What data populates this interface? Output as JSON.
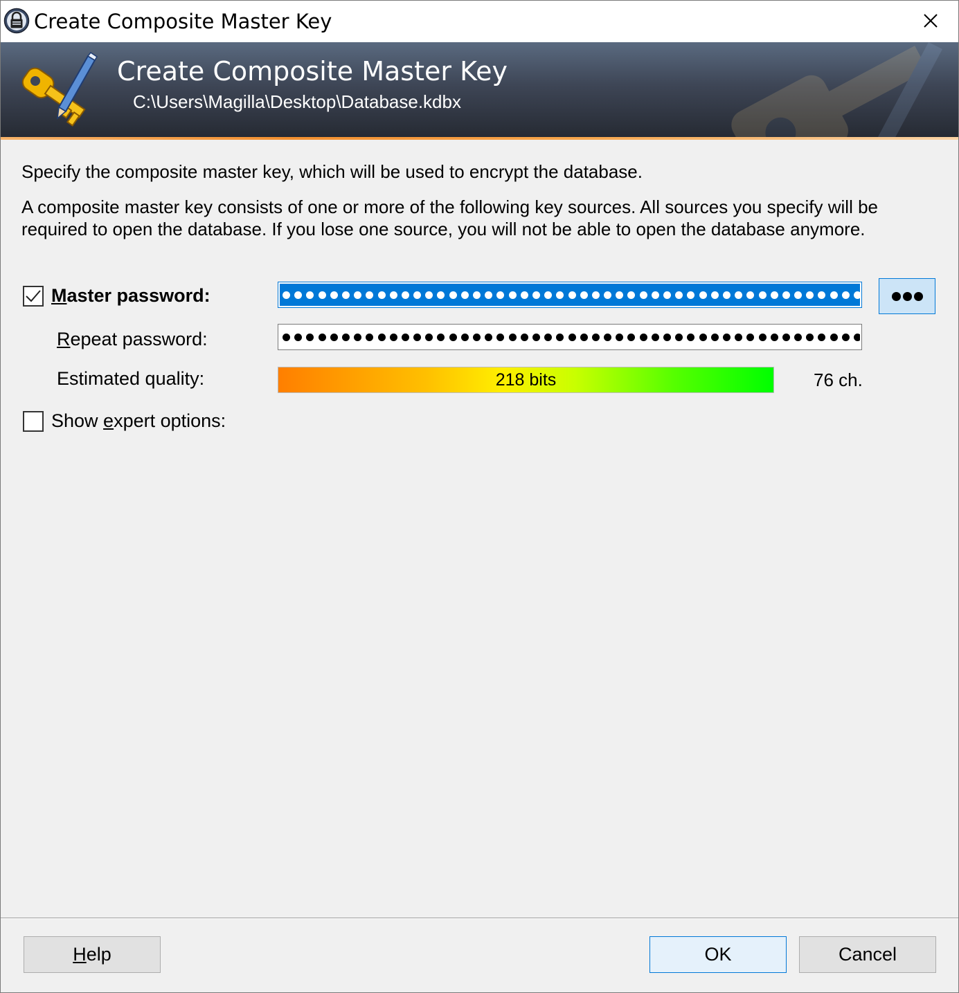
{
  "window": {
    "title": "Create Composite Master Key",
    "close_glyph": "✕"
  },
  "banner": {
    "title": "Create Composite Master Key",
    "subtitle": "C:\\Users\\Magilla\\Desktop\\Database.kdbx"
  },
  "intro": {
    "line1": "Specify the composite master key, which will be used to encrypt the database.",
    "line2": "A composite master key consists of one or more of the following key sources. All sources you specify will be required to open the database. If you lose one source, you will not be able to open the database anymore."
  },
  "master_password": {
    "checked": true,
    "label_mnemonic": "M",
    "label_rest": "aster password:",
    "masked_value_length": 76
  },
  "repeat_password": {
    "label_mnemonic": "R",
    "label_rest": "epeat password:",
    "masked_value_length": 76
  },
  "quality": {
    "label": "Estimated quality:",
    "bits_text": "218 bits",
    "fill_fraction": 1.0,
    "char_count_text": "76 ch."
  },
  "expert_options": {
    "checked": false,
    "label_pre": "Show ",
    "label_mnemonic": "e",
    "label_rest": "xpert options:"
  },
  "buttons": {
    "help_mnemonic": "H",
    "help_rest": "elp",
    "ok": "OK",
    "cancel": "Cancel"
  },
  "icons": {
    "app": "keepass-lock-icon",
    "banner": "key-pencil-icon",
    "reveal": "reveal-password-dots-icon",
    "close": "close-icon"
  },
  "colors": {
    "selection_blue": "#0078d7",
    "default_button_fill": "#e5f1fb",
    "reveal_button_fill": "#cce4f7"
  }
}
